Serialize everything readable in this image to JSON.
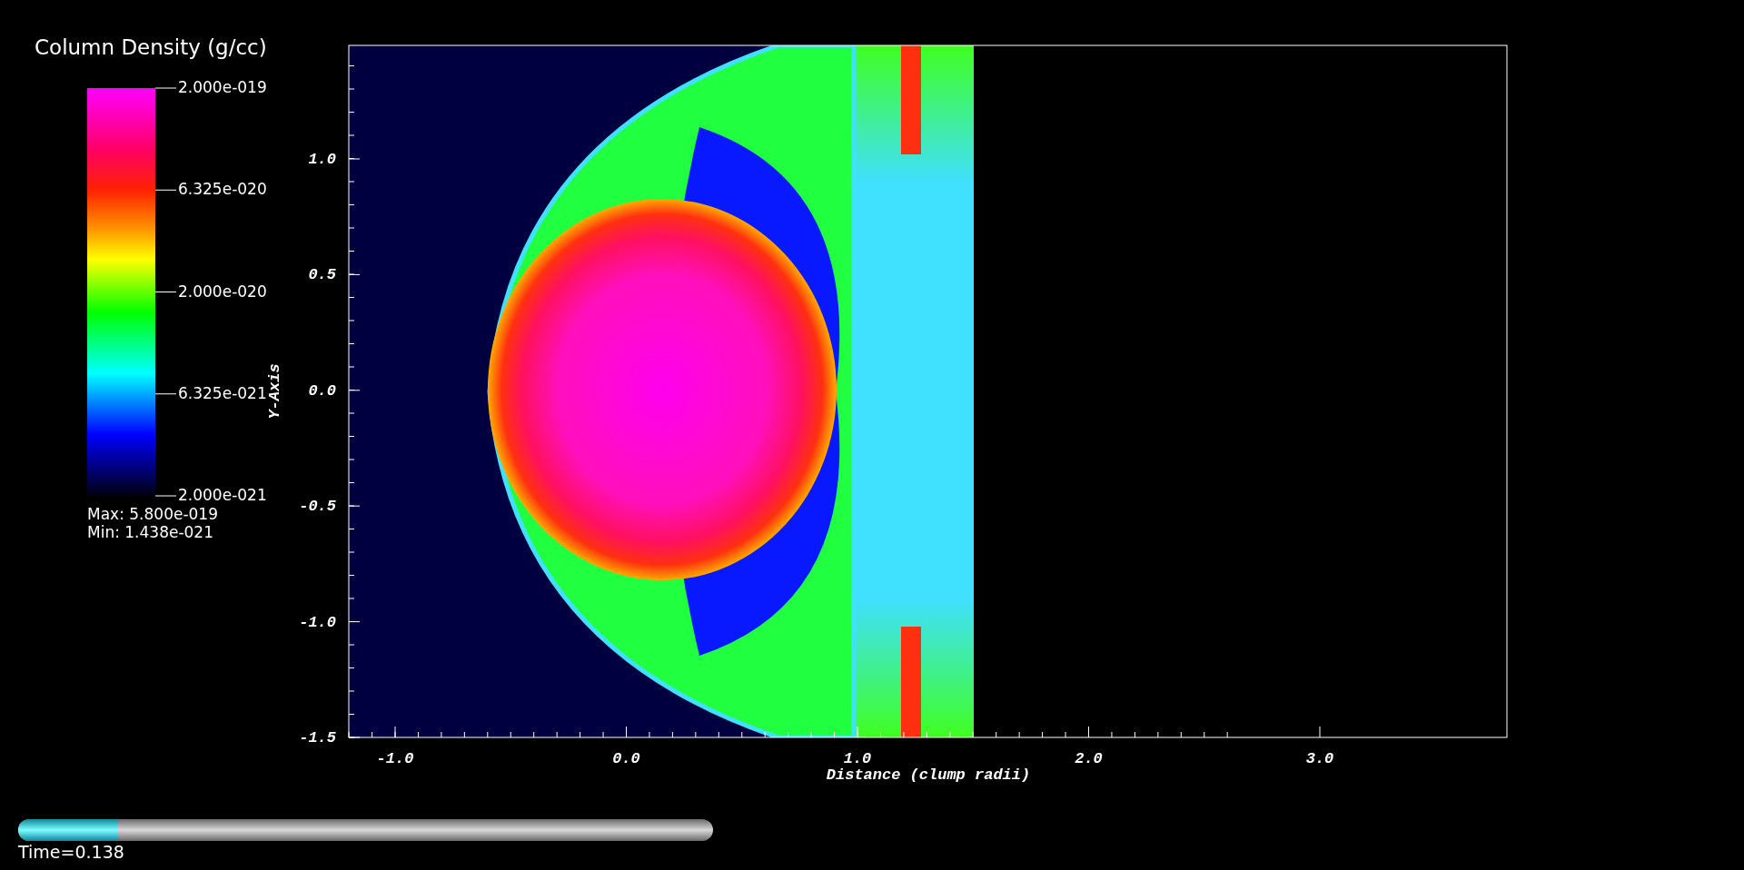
{
  "legend": {
    "title": "Column Density (g/cc)",
    "labels": [
      "2.000e-019",
      "6.325e-020",
      "2.000e-020",
      "6.325e-021",
      "2.000e-021"
    ],
    "max": "Max:  5.800e-019",
    "min": "Min:  1.438e-021"
  },
  "plot": {
    "xlabel": "Distance (clump radii)",
    "ylabel": "Y-Axis",
    "xticks": [
      "-1.0",
      "0.0",
      "1.0",
      "2.0",
      "3.0"
    ],
    "yticks": [
      "1.0",
      "0.5",
      "0.0",
      "-0.5",
      "-1.0",
      "-1.5"
    ]
  },
  "time_slider": {
    "level": 0.144
  },
  "time_label": "Time=0.138"
}
